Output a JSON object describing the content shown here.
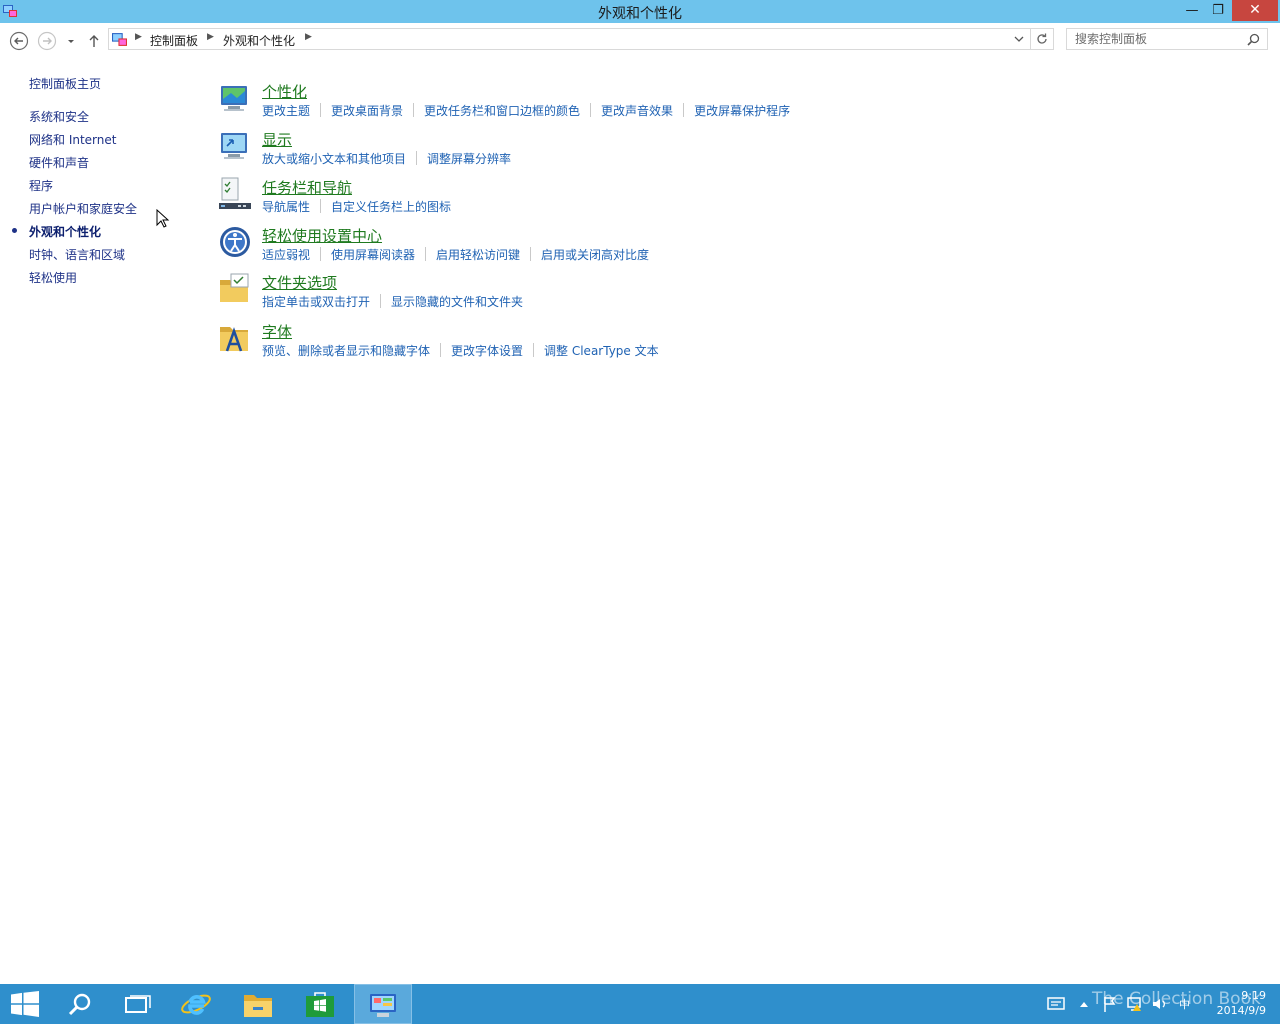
{
  "window": {
    "title": "外观和个性化",
    "minimize_glyph": "—",
    "maximize_glyph": "❐",
    "close_glyph": "✕"
  },
  "address": {
    "breadcrumbs": [
      "控制面板",
      "外观和个性化"
    ],
    "search_placeholder": "搜索控制面板"
  },
  "sidebar": {
    "home": "控制面板主页",
    "items": [
      {
        "label": "系统和安全"
      },
      {
        "label": "网络和 Internet"
      },
      {
        "label": "硬件和声音"
      },
      {
        "label": "程序"
      },
      {
        "label": "用户帐户和家庭安全"
      },
      {
        "label": "外观和个性化",
        "active": true
      },
      {
        "label": "时钟、语言和区域"
      },
      {
        "label": "轻松使用"
      }
    ]
  },
  "categories": [
    {
      "title": "个性化",
      "icon": "personalization-icon",
      "links": [
        "更改主题",
        "更改桌面背景",
        "更改任务栏和窗口边框的颜色",
        "更改声音效果",
        "更改屏幕保护程序"
      ]
    },
    {
      "title": "显示",
      "icon": "display-icon",
      "links": [
        "放大或缩小文本和其他项目",
        "调整屏幕分辨率"
      ]
    },
    {
      "title": "任务栏和导航",
      "icon": "taskbar-icon",
      "links": [
        "导航属性",
        "自定义任务栏上的图标"
      ]
    },
    {
      "title": "轻松使用设置中心",
      "icon": "ease-of-access-icon",
      "links": [
        "适应弱视",
        "使用屏幕阅读器",
        "启用轻松访问键",
        "启用或关闭高对比度"
      ]
    },
    {
      "title": "文件夹选项",
      "icon": "folder-options-icon",
      "links": [
        "指定单击或双击打开",
        "显示隐藏的文件和文件夹"
      ]
    },
    {
      "title": "字体",
      "icon": "fonts-icon",
      "links": [
        "预览、删除或者显示和隐藏字体",
        "更改字体设置",
        "调整 ClearType 文本"
      ]
    }
  ],
  "taskbar": {
    "ime": "中",
    "time": "9:19",
    "date": "2014/9/9",
    "watermark": "The Collection Book"
  },
  "colors": {
    "titlebar": "#6ec3ec",
    "taskbar": "#2f8fcc",
    "category_title": "#1f7a1f",
    "link": "#1f62b3",
    "sidebar_link": "#1e3287"
  }
}
